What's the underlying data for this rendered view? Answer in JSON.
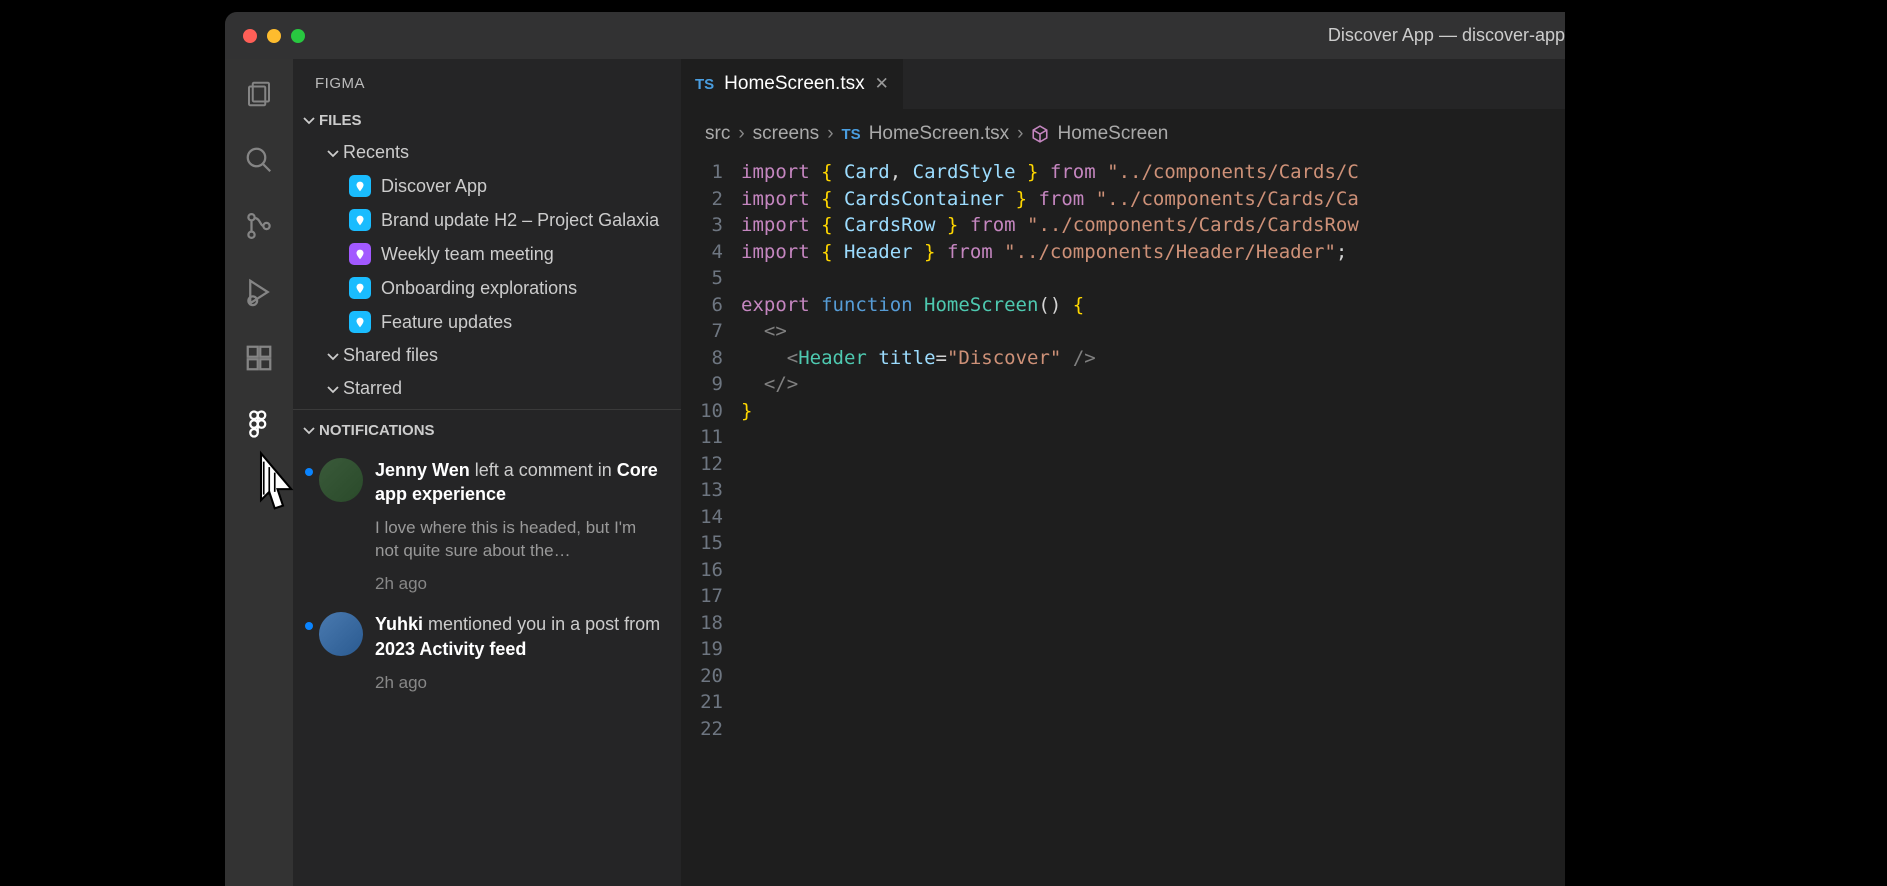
{
  "window": {
    "title": "Discover App — discover-app"
  },
  "sidebar": {
    "title": "FIGMA",
    "sections": {
      "files": {
        "label": "FILES",
        "recents": {
          "label": "Recents",
          "items": [
            {
              "name": "Discover App",
              "iconColor": "blue"
            },
            {
              "name": "Brand update H2 – Project Galaxia",
              "iconColor": "blue"
            },
            {
              "name": "Weekly team meeting",
              "iconColor": "purple"
            },
            {
              "name": "Onboarding explorations",
              "iconColor": "blue"
            },
            {
              "name": "Feature updates",
              "iconColor": "blue"
            }
          ]
        },
        "shared": {
          "label": "Shared files"
        },
        "starred": {
          "label": "Starred"
        }
      },
      "notifications": {
        "label": "NOTIFICATIONS",
        "items": [
          {
            "actor": "Jenny Wen",
            "action": " left a comment in ",
            "target": "Core app experience",
            "preview": "I love where this is headed, but I'm not quite sure about the…",
            "time": "2h ago",
            "unread": true
          },
          {
            "actor": "Yuhki",
            "action": " mentioned you in a post from ",
            "target": "2023 Activity feed",
            "preview": "",
            "time": "2h ago",
            "unread": true
          }
        ]
      }
    }
  },
  "tabs": {
    "active": {
      "icon": "TS",
      "name": "HomeScreen.tsx"
    }
  },
  "breadcrumbs": {
    "parts": [
      "src",
      "screens",
      "HomeScreen.tsx",
      "HomeScreen"
    ]
  },
  "code": {
    "lineCount": 22,
    "lines": [
      {
        "n": 1,
        "tokens": [
          [
            "kw",
            "import "
          ],
          [
            "br",
            "{ "
          ],
          [
            "id",
            "Card"
          ],
          [
            "",
            ", "
          ],
          [
            "id",
            "CardStyle"
          ],
          [
            "br",
            " }"
          ],
          [
            "",
            " "
          ],
          [
            "kw",
            "from"
          ],
          [
            "",
            " "
          ],
          [
            "str",
            "\"../components/Cards/C"
          ]
        ]
      },
      {
        "n": 2,
        "tokens": [
          [
            "kw",
            "import "
          ],
          [
            "br",
            "{ "
          ],
          [
            "id",
            "CardsContainer"
          ],
          [
            "br",
            " }"
          ],
          [
            "",
            " "
          ],
          [
            "kw",
            "from"
          ],
          [
            "",
            " "
          ],
          [
            "str",
            "\"../components/Cards/Ca"
          ]
        ]
      },
      {
        "n": 3,
        "tokens": [
          [
            "kw",
            "import "
          ],
          [
            "br",
            "{ "
          ],
          [
            "id",
            "CardsRow"
          ],
          [
            "br",
            " }"
          ],
          [
            "",
            " "
          ],
          [
            "kw",
            "from"
          ],
          [
            "",
            " "
          ],
          [
            "str",
            "\"../components/Cards/CardsRow"
          ]
        ]
      },
      {
        "n": 4,
        "tokens": [
          [
            "kw",
            "import "
          ],
          [
            "br",
            "{ "
          ],
          [
            "id",
            "Header"
          ],
          [
            "br",
            " }"
          ],
          [
            "",
            " "
          ],
          [
            "kw",
            "from"
          ],
          [
            "",
            " "
          ],
          [
            "str",
            "\"../components/Header/Header\""
          ],
          [
            "",
            ";"
          ]
        ]
      },
      {
        "n": 5,
        "tokens": []
      },
      {
        "n": 6,
        "tokens": [
          [
            "kw",
            "export "
          ],
          [
            "fn",
            "function "
          ],
          [
            "cls",
            "HomeScreen"
          ],
          [
            "",
            "() "
          ],
          [
            "br",
            "{"
          ]
        ]
      },
      {
        "n": 7,
        "tokens": [
          [
            "",
            "  "
          ],
          [
            "punc",
            "<>"
          ]
        ]
      },
      {
        "n": 8,
        "tokens": [
          [
            "",
            "    "
          ],
          [
            "punc",
            "<"
          ],
          [
            "tag",
            "Header"
          ],
          [
            "",
            " "
          ],
          [
            "attr",
            "title"
          ],
          [
            "",
            "="
          ],
          [
            "str",
            "\"Discover\""
          ],
          [
            "",
            " "
          ],
          [
            "punc",
            "/>"
          ]
        ]
      },
      {
        "n": 9,
        "tokens": [
          [
            "",
            "  "
          ],
          [
            "punc",
            "</>"
          ]
        ]
      },
      {
        "n": 10,
        "tokens": [
          [
            "br",
            "}"
          ]
        ]
      }
    ]
  }
}
